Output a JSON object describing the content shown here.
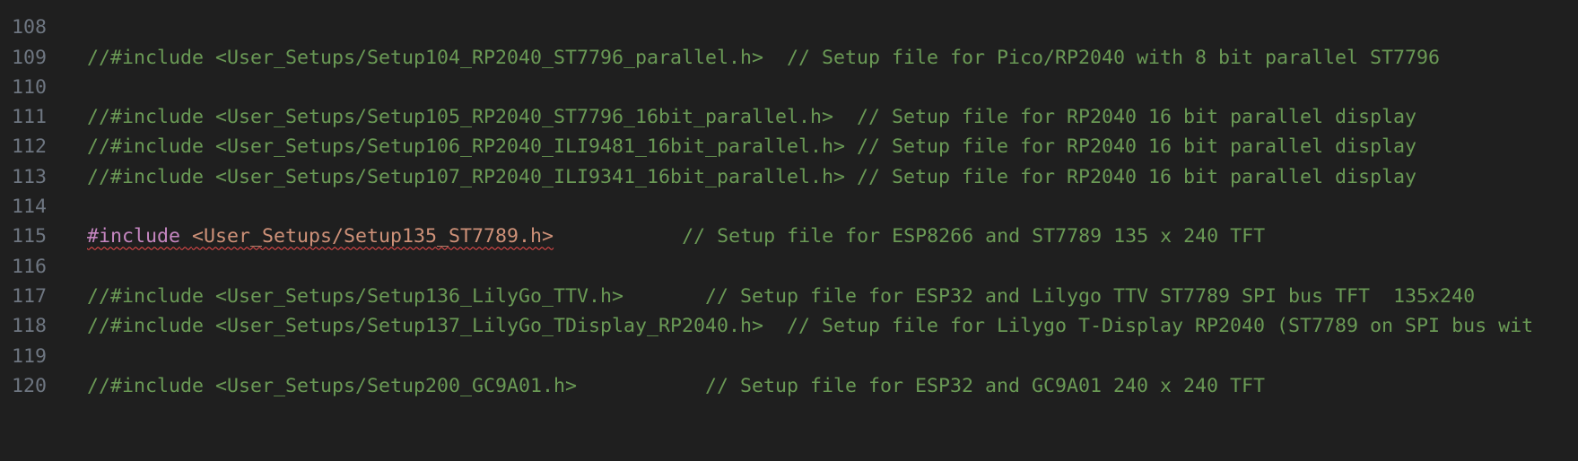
{
  "editor": {
    "lines": [
      {
        "number": "108",
        "text": "//#include <User_Setups/Setup104_RP2040_ST7796_parallel.h>  // Setup file for Pico/RP2040 with 8 bit parallel ST7796"
      },
      {
        "number": "109",
        "text": ""
      },
      {
        "number": "110",
        "text": "//#include <User_Setups/Setup105_RP2040_ST7796_16bit_parallel.h>  // Setup file for RP2040 16 bit parallel display"
      },
      {
        "number": "111",
        "text": "//#include <User_Setups/Setup106_RP2040_ILI9481_16bit_parallel.h> // Setup file for RP2040 16 bit parallel display"
      },
      {
        "number": "112",
        "text": "//#include <User_Setups/Setup107_RP2040_ILI9341_16bit_parallel.h> // Setup file for RP2040 16 bit parallel display"
      },
      {
        "number": "113",
        "text": ""
      },
      {
        "number": "114",
        "directive": "#include",
        "space": " ",
        "header": "<User_Setups/Setup135_ST7789.h>",
        "comment": "           // Setup file for ESP8266 and ST7789 135 x 240 TFT"
      },
      {
        "number": "115",
        "text": ""
      },
      {
        "number": "116",
        "text": "//#include <User_Setups/Setup136_LilyGo_TTV.h>       // Setup file for ESP32 and Lilygo TTV ST7789 SPI bus TFT  135x240"
      },
      {
        "number": "117",
        "text": "//#include <User_Setups/Setup137_LilyGo_TDisplay_RP2040.h>  // Setup file for Lilygo T-Display RP2040 (ST7789 on SPI bus wit"
      },
      {
        "number": "118",
        "text": ""
      },
      {
        "number": "119",
        "text": "//#include <User_Setups/Setup200_GC9A01.h>           // Setup file for ESP32 and GC9A01 240 x 240 TFT"
      },
      {
        "number": "120",
        "text": ""
      }
    ]
  },
  "colors": {
    "background": "#1f1f1f",
    "line_number": "#6e7681",
    "comment": "#6a9955",
    "directive": "#c586c0",
    "string_header": "#ce9178",
    "error_squiggle": "#f14c4c"
  }
}
